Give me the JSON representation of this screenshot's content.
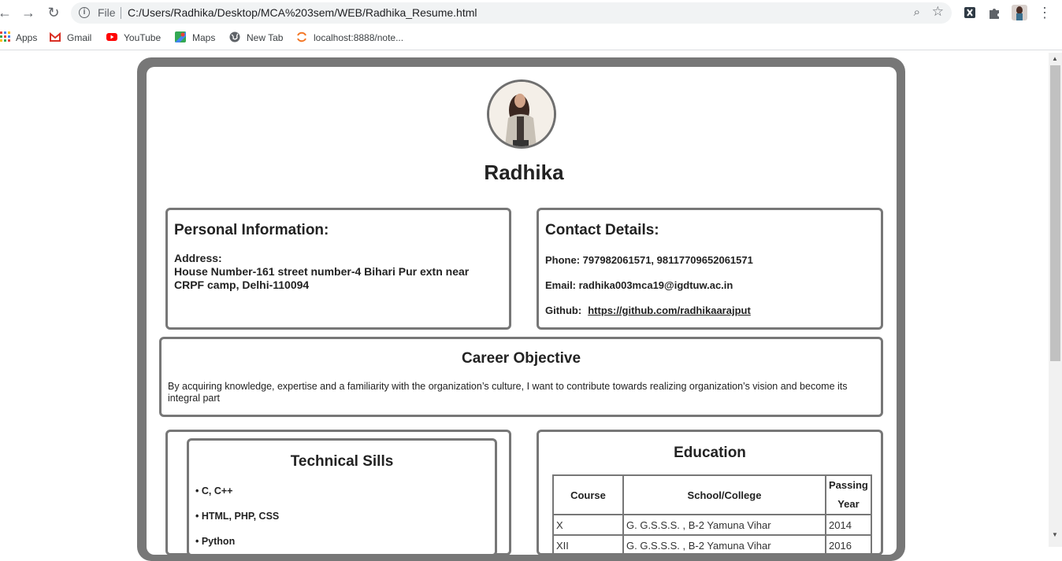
{
  "browser": {
    "scheme_label": "File",
    "url": "C:/Users/Radhika/Desktop/MCA%203sem/WEB/Radhika_Resume.html",
    "bookmarks": [
      "Apps",
      "Gmail",
      "YouTube",
      "Maps",
      "New Tab",
      "localhost:8888/note..."
    ]
  },
  "resume": {
    "name": "Radhika",
    "personal": {
      "title": "Personal Information:",
      "address_label": "Address:",
      "address": "House Number-161 street number-4 Bihari Pur extn near CRPF camp, Delhi-110094"
    },
    "contact": {
      "title": "Contact Details:",
      "phone": "Phone: 797982061571, 98117709652061571",
      "email": "Email: radhika003mca19@igdtuw.ac.in",
      "github_label": "Github:",
      "github_url": "https://github.com/radhikaarajput"
    },
    "objective": {
      "title": "Career Objective",
      "text": "By acquiring knowledge, expertise and a familiarity with the organization’s culture, I want to contribute towards realizing organization’s vision and become its integral part"
    },
    "skills": {
      "title": "Technical Sills",
      "items": [
        "• C, C++",
        "• HTML, PHP, CSS",
        "• Python"
      ]
    },
    "education": {
      "title": "Education",
      "headers": [
        "Course",
        "School/College",
        "Passing Year"
      ],
      "rows": [
        [
          "X",
          "G. G.S.S.S. , B-2 Yamuna Vihar",
          "2014"
        ],
        [
          "XII",
          "G. G.S.S.S. , B-2 Yamuna Vihar",
          "2016"
        ]
      ]
    }
  }
}
